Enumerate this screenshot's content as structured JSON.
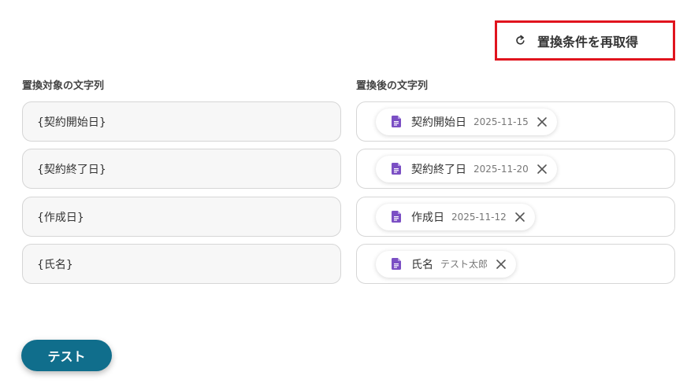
{
  "header": {
    "refetch_label": "置換条件を再取得",
    "refetch_icon": "refresh-icon",
    "highlight_color": "#e0141e"
  },
  "columns": {
    "source_label": "置換対象の文字列",
    "target_label": "置換後の文字列"
  },
  "rows": [
    {
      "source": "{契約開始日}",
      "chip_name": "契約開始日",
      "chip_value": "2025-11-15",
      "chip_icon": "document-icon"
    },
    {
      "source": "{契約終了日}",
      "chip_name": "契約終了日",
      "chip_value": "2025-11-20",
      "chip_icon": "document-icon"
    },
    {
      "source": "{作成日}",
      "chip_name": "作成日",
      "chip_value": "2025-11-12",
      "chip_icon": "document-icon"
    },
    {
      "source": "{氏名}",
      "chip_name": "氏名",
      "chip_value": "テスト太郎",
      "chip_icon": "document-icon"
    }
  ],
  "footer": {
    "test_label": "テスト",
    "test_color": "#106e8c"
  },
  "colors": {
    "doc_icon": "#7b4fc4"
  }
}
